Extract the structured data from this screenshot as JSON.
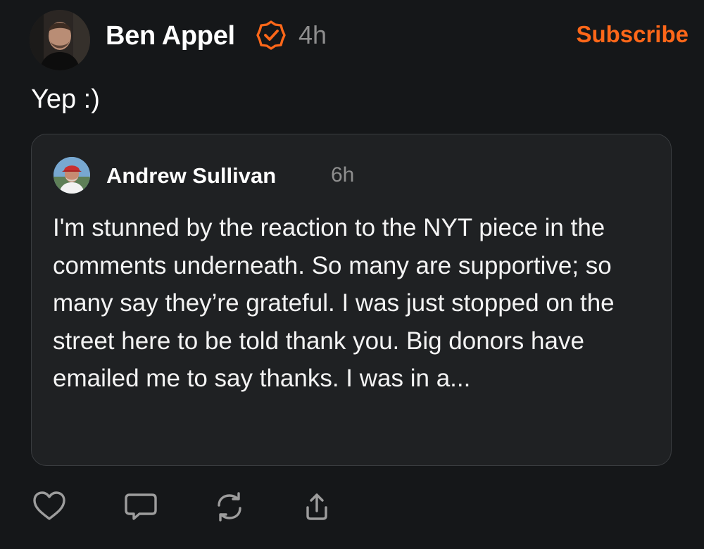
{
  "post": {
    "author": "Ben Appel",
    "time": "4h",
    "subscribe_label": "Subscribe",
    "text": "Yep :)"
  },
  "quoted_post": {
    "author": "Andrew Sullivan",
    "time": "6h",
    "text": "I'm stunned by the reaction to the NYT piece in the comments underneath. So many are supportive; so many say they’re grateful. I was just stopped on the street here to be told thank you. Big donors have emailed me to say thanks. I was in a..."
  },
  "actions": [
    {
      "icon": "heart-icon"
    },
    {
      "icon": "comment-icon"
    },
    {
      "icon": "restack-icon"
    },
    {
      "icon": "share-icon"
    }
  ],
  "colors": {
    "background": "#151719",
    "card_background": "#1f2123",
    "accent": "#ff6719",
    "muted_text": "#8e8e8e"
  }
}
